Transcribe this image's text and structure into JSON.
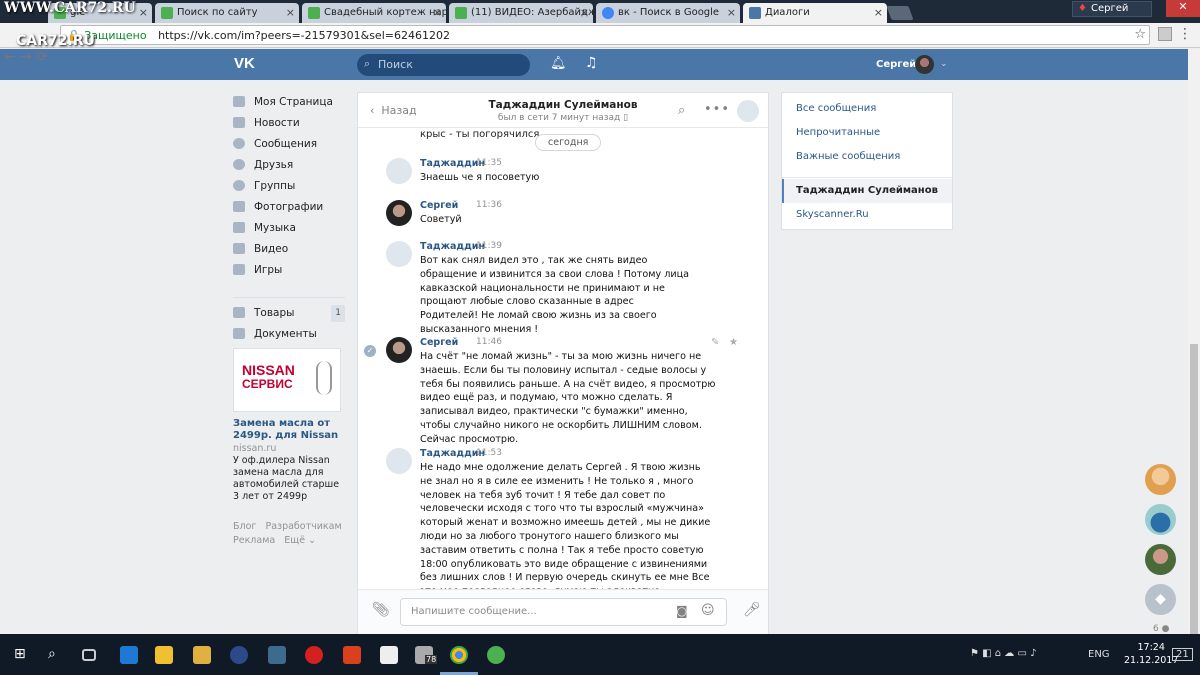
{
  "watermark": {
    "top": "WWW.CAR72.RU",
    "bottom": "CAR72.RU"
  },
  "browser": {
    "tabs": [
      {
        "title": "gle",
        "icon": "green-page-icon",
        "color": "#4caf50"
      },
      {
        "title": "Поиск по сайту",
        "icon": "green-page-icon",
        "color": "#4caf50"
      },
      {
        "title": "Свадебный кортеж нар",
        "icon": "green-page-icon",
        "color": "#4caf50"
      },
      {
        "title": "(11) ВИДЕО: Азербайдж",
        "icon": "green-page-icon",
        "color": "#4caf50"
      },
      {
        "title": "вк - Поиск в Google",
        "icon": "google-icon",
        "color": "#4285f4"
      },
      {
        "title": "Диалоги",
        "icon": "vk-icon",
        "color": "#4a76a8"
      }
    ],
    "user": "Сергей",
    "secure_label": "Защищено",
    "url": "https://vk.com/im?peers=-21579301&sel=62461202"
  },
  "vk": {
    "search_placeholder": "Поиск",
    "user_name": "Сергей",
    "menu": [
      {
        "label": "Моя Страница",
        "icon": "home-icon"
      },
      {
        "label": "Новости",
        "icon": "news-icon"
      },
      {
        "label": "Сообщения",
        "icon": "messages-icon"
      },
      {
        "label": "Друзья",
        "icon": "friends-icon"
      },
      {
        "label": "Группы",
        "icon": "groups-icon"
      },
      {
        "label": "Фотографии",
        "icon": "camera-icon"
      },
      {
        "label": "Музыка",
        "icon": "music-icon"
      },
      {
        "label": "Видео",
        "icon": "video-icon"
      },
      {
        "label": "Игры",
        "icon": "games-icon"
      },
      {
        "label": "Товары",
        "icon": "bag-icon",
        "count": "1"
      },
      {
        "label": "Документы",
        "icon": "document-icon"
      }
    ],
    "ad": {
      "logo_top": "NISSAN",
      "logo_bottom": "СЕРВИС",
      "title": "Замена масла от 2499р. для Nissan",
      "domain": "nissan.ru",
      "text": "У оф.дилера Nissan замена масла для автомобилей старше 3 лет от 2499р"
    },
    "footer": {
      "blog": "Блог",
      "dev": "Разработчикам",
      "ads": "Реклама",
      "more": "Ещё"
    }
  },
  "dialog": {
    "back": "Назад",
    "name": "Таджаддин Сулейманов",
    "status": "был в сети 7 минут назад",
    "date_separator": "сегодня",
    "cut_text": "крыс - ты погорячился...",
    "messages": [
      {
        "author": "Таджаддин",
        "time": "11:35",
        "text": "Знаешь че я посоветую",
        "me": false
      },
      {
        "author": "Сергей",
        "time": "11:36",
        "text": "Советуй",
        "me": true
      },
      {
        "author": "Таджаддин",
        "time": "11:39",
        "text": "Вот как снял видел это , так же снять видео обращение и извинится за свои слова ! Потому лица кавказской национальности не принимают и не прощают любые слово сказанные в адрес Родителей! Не ломай свою жизнь из за своего высказанного мнения !",
        "me": false
      },
      {
        "author": "Сергей",
        "time": "11:46",
        "text": "На счёт \"не ломай жизнь\" - ты за мою жизнь ничего не знаешь. Если бы ты половину испытал - седые волосы у тебя бы появились раньше. А на счёт видео, я просмотрю видео ещё раз, и подумаю, что можно сделать. Я записывал видео, практически \"с бумажки\" именно, чтобы случайно никого не оскорбить ЛИШНИМ словом. Сейчас просмотрю.",
        "me": true
      },
      {
        "author": "Таджаддин",
        "time": "11:53",
        "text": "Не надо мне одолжение делать Сергей . Я твою жизнь не знал но я в силе ее изменить ! Не только я , много человек на тебя зуб точит ! Я тебе дал совет по человечески исходя с того что ты взрослый «мужчина» который женат и возможно имеешь детей , мы не дикие люди но за любого тронутого нашего близкого мы заставим ответить с полна ! Так я тебе просто советую 18:00 опубликовать это виде обращение с извинениями без лишних слов ! И первую очередь скинуть ее мне Все это мое последнее слово, думаю ты адекватно",
        "me": false
      }
    ],
    "compose_placeholder": "Напишите сообщение..."
  },
  "right_panel": {
    "filters": [
      "Все сообщения",
      "Непрочитанные",
      "Важные сообщения"
    ],
    "selected": "Таджаддин Сулейманов",
    "other": "Skyscanner.Ru"
  },
  "online_count": "6",
  "taskbar": {
    "lang": "ENG",
    "time": "17:24",
    "date": "21.12.2017",
    "badge": "78",
    "notif": "21"
  }
}
